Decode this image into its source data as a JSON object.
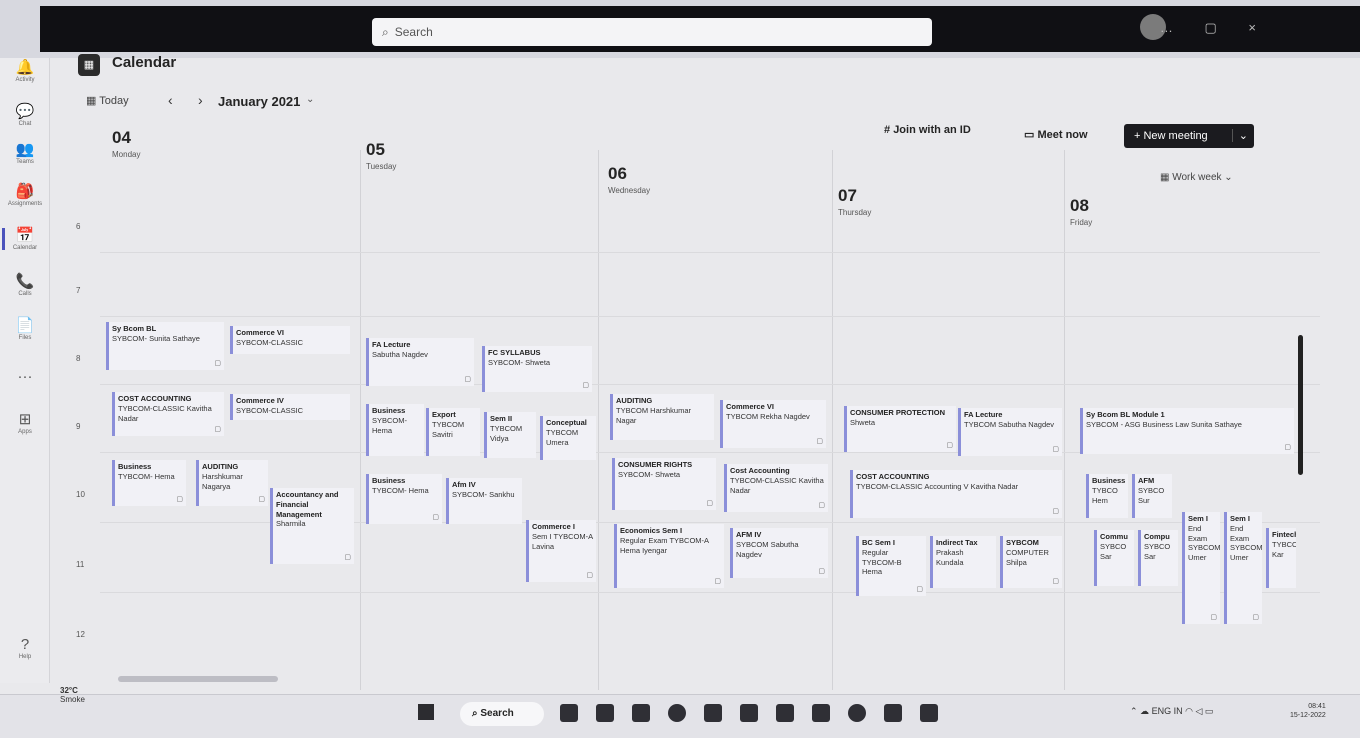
{
  "window": {
    "search_placeholder": "Search",
    "controls": "… ▢ ×"
  },
  "rail": [
    {
      "icon": "bell-icon",
      "glyph": "🔔",
      "label": "Activity"
    },
    {
      "icon": "chat-icon",
      "glyph": "💬",
      "label": "Chat"
    },
    {
      "icon": "teams-icon",
      "glyph": "👥",
      "label": "Teams"
    },
    {
      "icon": "assignments-icon",
      "glyph": "🎒",
      "label": "Assignments"
    },
    {
      "icon": "calendar-icon",
      "glyph": "📅",
      "label": "Calendar"
    },
    {
      "icon": "phone-icon",
      "glyph": "📞",
      "label": "Calls"
    },
    {
      "icon": "file-icon",
      "glyph": "📄",
      "label": "Files"
    },
    {
      "icon": "more-icon",
      "glyph": "···",
      "label": ""
    },
    {
      "icon": "apps-icon",
      "glyph": "⊞",
      "label": "Apps"
    },
    {
      "icon": "help-icon",
      "glyph": "?",
      "label": "Help"
    }
  ],
  "header": {
    "title": "Calendar",
    "today": "Today",
    "month": "January 2021",
    "join": "Join with an ID",
    "meet_now": "Meet now",
    "new_meeting": "New meeting",
    "view": "Work week"
  },
  "days": [
    {
      "num": "04",
      "name": "Monday"
    },
    {
      "num": "05",
      "name": "Tuesday"
    },
    {
      "num": "06",
      "name": "Wednesday"
    },
    {
      "num": "07",
      "name": "Thursday"
    },
    {
      "num": "08",
      "name": "Friday"
    }
  ],
  "hours": [
    "6",
    "7",
    "8",
    "9",
    "10",
    "11",
    "12"
  ],
  "events": [
    {
      "title": "Sy Bcom BL",
      "sub": "SYBCOM- Sunita Sathaye"
    },
    {
      "title": "Commerce VI",
      "sub": "SYBCOM-CLASSIC"
    },
    {
      "title": "FA Lecture",
      "sub": "Sabutha Nagdev"
    },
    {
      "title": "FC SYLLABUS",
      "sub": "SYBCOM- Shweta"
    },
    {
      "title": "COST ACCOUNTING",
      "sub": "TYBCOM-CLASSIC Kavitha Nadar"
    },
    {
      "title": "Commerce IV",
      "sub": "SYBCOM-CLASSIC"
    },
    {
      "title": "Business",
      "sub": "SYBCOM- Hema"
    },
    {
      "title": "Export",
      "sub": "TYBCOM Savitri"
    },
    {
      "title": "Sem II",
      "sub": "TYBCOM Vidya"
    },
    {
      "title": "Conceptual",
      "sub": "TYBCOM Umera"
    },
    {
      "title": "AUDITING",
      "sub": "TYBCOM Harshkumar Nagar"
    },
    {
      "title": "Commerce VI",
      "sub": "TYBCOM Rekha Nagdev"
    },
    {
      "title": "CONSUMER PROTECTION",
      "sub": "Shweta"
    },
    {
      "title": "FA Lecture",
      "sub": "TYBCOM Sabutha Nagdev"
    },
    {
      "title": "Sy Bcom BL Module 1",
      "sub": "SYBCOM - ASG Business Law Sunita Sathaye"
    },
    {
      "title": "Business",
      "sub": "TYBCOM- Hema"
    },
    {
      "title": "AUDITING",
      "sub": "Harshkumar Nagarya"
    },
    {
      "title": "Accountancy and Financial Management",
      "sub": "Sharmila"
    },
    {
      "title": "Business",
      "sub": "TYBCOM- Hema"
    },
    {
      "title": "Afm IV",
      "sub": "SYBCOM- Sankhu"
    },
    {
      "title": "CONSUMER RIGHTS",
      "sub": "SYBCOM- Shweta"
    },
    {
      "title": "Cost Accounting",
      "sub": "TYBCOM-CLASSIC Kavitha Nadar"
    },
    {
      "title": "COST ACCOUNTING",
      "sub": "TYBCOM-CLASSIC Accounting V Kavitha Nadar"
    },
    {
      "title": "Business",
      "sub": "TYBCO Hem"
    },
    {
      "title": "AFM",
      "sub": "SYBCO Sur"
    },
    {
      "title": "Commerce I",
      "sub": "Sem I TYBCOM-A Lavina"
    },
    {
      "title": "Economics Sem I",
      "sub": "Regular Exam TYBCOM-A Hema Iyengar"
    },
    {
      "title": "AFM IV",
      "sub": "SYBCOM Sabutha Nagdev"
    },
    {
      "title": "BC Sem I",
      "sub": "Regular TYBCOM-B Hema"
    },
    {
      "title": "Indirect Tax",
      "sub": "Prakash Kundala"
    },
    {
      "title": "SYBCOM",
      "sub": "COMPUTER Shilpa"
    },
    {
      "title": "Commu",
      "sub": "SYBCO Sar"
    },
    {
      "title": "Compu",
      "sub": "SYBCO Sar"
    },
    {
      "title": "Sem I",
      "sub": "End Exam SYBCOM Umer"
    },
    {
      "title": "Sem I",
      "sub": "End Exam SYBCOM Umer"
    },
    {
      "title": "Fintech",
      "sub": "TYBCOM Kar"
    }
  ],
  "taskbar": {
    "weather_temp": "32°C",
    "weather_desc": "Smoke",
    "search": "Search",
    "tray": "ENG IN",
    "time": "08:41",
    "date": "15-12-2022"
  }
}
